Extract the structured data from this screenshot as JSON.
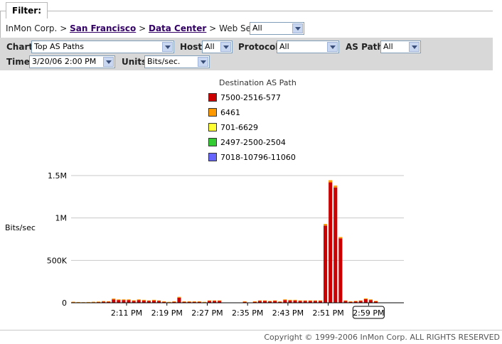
{
  "filter": {
    "tab_label": "Filter:",
    "breadcrumb": {
      "root": "InMon Corp.",
      "sep": ">",
      "link1": "San Francisco",
      "link2": "Data Center",
      "current": "Web Servers",
      "scope_value": "All"
    }
  },
  "controls": {
    "chart_label": "Chart",
    "chart_value": "Top AS Paths",
    "host_label": "Host",
    "host_value": "All",
    "protocol_label": "Protocol",
    "protocol_value": "All",
    "aspath_label": "AS Path",
    "aspath_value": "All",
    "time_label": "Time",
    "time_value": "3/20/06 2:00 PM",
    "units_label": "Units",
    "units_value": "Bits/sec."
  },
  "legend": {
    "title": "Destination AS Path",
    "items": [
      {
        "label": "7500-2516-577",
        "color": "#cc0000"
      },
      {
        "label": "6461",
        "color": "#ff9900"
      },
      {
        "label": "701-6629",
        "color": "#ffff33"
      },
      {
        "label": "2497-2500-2504",
        "color": "#33cc33"
      },
      {
        "label": "7018-10796-11060",
        "color": "#6666ff"
      }
    ]
  },
  "chart_data": {
    "type": "bar",
    "ylabel": "Bits/sec",
    "ylim": [
      0,
      1500000
    ],
    "y_ticks": [
      {
        "value": 0,
        "label": "0"
      },
      {
        "value": 500000,
        "label": "500K"
      },
      {
        "value": 1000000,
        "label": "1M"
      },
      {
        "value": 1500000,
        "label": "1.5M"
      }
    ],
    "x_range_minutes": [
      0,
      66
    ],
    "x_ticks": [
      {
        "minute": 11,
        "label": "2:11 PM"
      },
      {
        "minute": 19,
        "label": "2:19 PM"
      },
      {
        "minute": 27,
        "label": "2:27 PM"
      },
      {
        "minute": 35,
        "label": "2:35 PM"
      },
      {
        "minute": 43,
        "label": "2:43 PM"
      },
      {
        "minute": 51,
        "label": "2:51 PM"
      },
      {
        "minute": 59,
        "label": "2:59 PM",
        "highlighted": true
      }
    ],
    "grid": true,
    "series": [
      {
        "name": "7500-2516-577",
        "color": "#cc0000",
        "values": [
          8000,
          6000,
          5000,
          6000,
          8000,
          9000,
          15000,
          13000,
          40000,
          32000,
          32000,
          32000,
          22000,
          32000,
          27000,
          22000,
          27000,
          22000,
          12000,
          8000,
          12000,
          60000,
          12000,
          12000,
          12000,
          12000,
          8000,
          22000,
          22000,
          22000,
          0,
          0,
          0,
          0,
          12000,
          0,
          12000,
          22000,
          22000,
          17000,
          22000,
          12000,
          32000,
          27000,
          27000,
          22000,
          22000,
          22000,
          22000,
          22000,
          910000,
          1420000,
          1360000,
          760000,
          22000,
          12000,
          17000,
          22000,
          42000,
          32000,
          17000,
          0,
          0,
          0,
          0,
          0
        ],
        "stacks": "approx"
      },
      {
        "name": "6461",
        "color": "#ff9900",
        "values": [
          4000,
          3000,
          2000,
          3000,
          4000,
          5000,
          5000,
          5000,
          10000,
          8000,
          8000,
          8000,
          8000,
          8000,
          8000,
          6000,
          8000,
          6000,
          5000,
          3000,
          5000,
          10000,
          5000,
          5000,
          5000,
          5000,
          3000,
          6000,
          6000,
          6000,
          0,
          0,
          0,
          0,
          5000,
          0,
          5000,
          6000,
          6000,
          5000,
          6000,
          5000,
          8000,
          8000,
          8000,
          6000,
          6000,
          6000,
          6000,
          6000,
          20000,
          25000,
          22000,
          15000,
          6000,
          5000,
          5000,
          6000,
          10000,
          8000,
          5000,
          0,
          0,
          0,
          0,
          0
        ]
      }
    ]
  },
  "footer": {
    "copyright": "Copyright © 1999-2006 InMon Corp. ALL RIGHTS RESERVED"
  }
}
